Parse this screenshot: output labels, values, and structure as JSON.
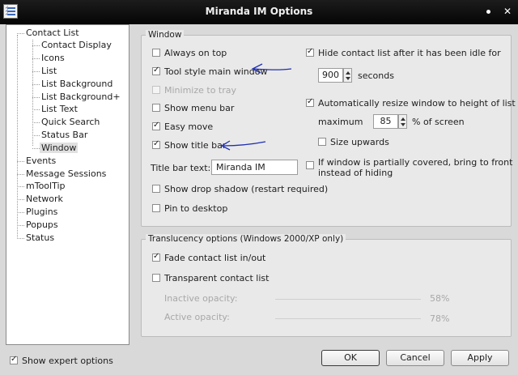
{
  "window": {
    "title": "Miranda IM Options"
  },
  "tree": {
    "items": [
      {
        "label": "Contact List"
      },
      {
        "label": "Contact Display"
      },
      {
        "label": "Icons"
      },
      {
        "label": "List"
      },
      {
        "label": "List Background"
      },
      {
        "label": "List Background+"
      },
      {
        "label": "List Text"
      },
      {
        "label": "Quick Search"
      },
      {
        "label": "Status Bar"
      },
      {
        "label": "Window"
      },
      {
        "label": "Events"
      },
      {
        "label": "Message Sessions"
      },
      {
        "label": "mToolTip"
      },
      {
        "label": "Network"
      },
      {
        "label": "Plugins"
      },
      {
        "label": "Popups"
      },
      {
        "label": "Status"
      }
    ],
    "selected": "Window"
  },
  "window_group": {
    "title": "Window",
    "always_on_top": {
      "label": "Always on top",
      "checked": false
    },
    "tool_style": {
      "label": "Tool style main window",
      "checked": true
    },
    "minimize_to_tray": {
      "label": "Minimize to tray",
      "checked": false,
      "disabled": true
    },
    "show_menu_bar": {
      "label": "Show menu bar",
      "checked": false
    },
    "easy_move": {
      "label": "Easy move",
      "checked": true
    },
    "show_title_bar": {
      "label": "Show title bar",
      "checked": true
    },
    "title_bar_text_label": "Title bar text:",
    "title_bar_text_value": "Miranda IM",
    "show_drop_shadow": {
      "label": "Show drop shadow (restart required)",
      "checked": false
    },
    "pin_to_desktop": {
      "label": "Pin to desktop",
      "checked": false
    },
    "hide_idle": {
      "label": "Hide contact list after it has been idle for",
      "checked": true
    },
    "idle_seconds": "900",
    "seconds_label": "seconds",
    "auto_resize": {
      "label": "Automatically resize window to height of list",
      "checked": true
    },
    "maximum_label": "maximum",
    "maximum_value": "85",
    "percent_screen_label": "% of screen",
    "size_upwards": {
      "label": "Size upwards",
      "checked": false
    },
    "partially_covered": {
      "label_line1": "If window is partially covered, bring to front",
      "label_line2": "instead of hiding",
      "checked": false
    }
  },
  "translucency_group": {
    "title": "Translucency options (Windows 2000/XP only)",
    "fade": {
      "label": "Fade contact list in/out",
      "checked": true
    },
    "transparent": {
      "label": "Transparent contact list",
      "checked": false
    },
    "inactive_label": "Inactive opacity:",
    "inactive_value": "58%",
    "active_label": "Active opacity:",
    "active_value": "78%"
  },
  "footer": {
    "expert": {
      "label": "Show expert options",
      "checked": true
    },
    "ok_label": "OK",
    "cancel_label": "Cancel",
    "apply_label": "Apply"
  },
  "colors": {
    "titlebar": "#0a0a0a",
    "annotation_arrow": "#1f2fb0"
  }
}
